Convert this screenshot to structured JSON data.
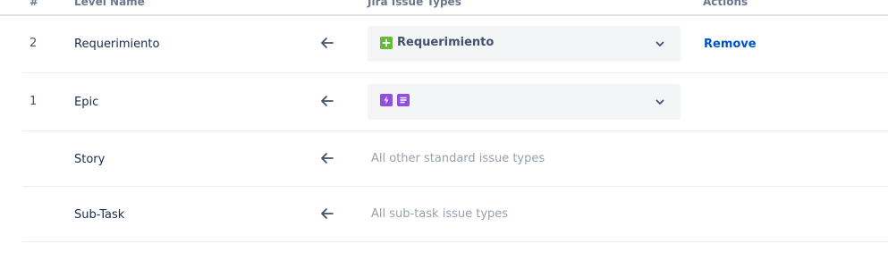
{
  "header": {
    "num": "#",
    "level_name": "Level Name",
    "issue_types": "Jira Issue Types",
    "actions": "Actions"
  },
  "rows": [
    {
      "num": "2",
      "level": "Requerimiento",
      "issue_types_selected": "Requerimiento",
      "issue_type_icons": [
        "requirement-icon"
      ],
      "action": "Remove"
    },
    {
      "num": "1",
      "level": "Epic",
      "issue_type_icons": [
        "epic-icon",
        "story-doc-icon"
      ]
    },
    {
      "num": "",
      "level": "Story",
      "issue_types_text": "All other standard issue types"
    },
    {
      "num": "",
      "level": "Sub-Task",
      "issue_types_text": "All sub-task issue types"
    }
  ],
  "colors": {
    "link": "#0052cc",
    "requirement_icon": "#63ba3c",
    "epic_icon": "#904ee2",
    "muted_text": "#97a0af",
    "dropdown_bg": "#f4f5f7"
  }
}
